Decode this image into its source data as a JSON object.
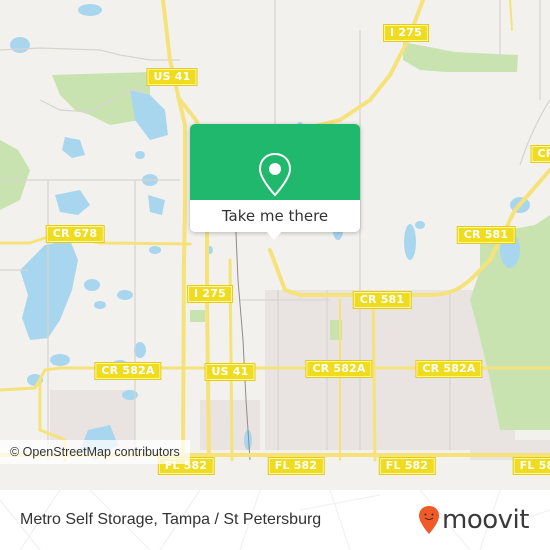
{
  "map": {
    "road_labels": [
      {
        "id": "i275-north",
        "text": "I 275"
      },
      {
        "id": "us41-north",
        "text": "US 41"
      },
      {
        "id": "cr678",
        "text": "CR 678"
      },
      {
        "id": "cr581-east",
        "text": "CR 581"
      },
      {
        "id": "cr581-ne",
        "text": "CR"
      },
      {
        "id": "i275-mid",
        "text": "I 275"
      },
      {
        "id": "cr581-mid",
        "text": "CR 581"
      },
      {
        "id": "cr582a-west",
        "text": "CR 582A"
      },
      {
        "id": "us41-mid",
        "text": "US 41"
      },
      {
        "id": "cr582a-mid",
        "text": "CR 582A"
      },
      {
        "id": "cr582a-east",
        "text": "CR 582A"
      },
      {
        "id": "fl582-1",
        "text": "FL 582"
      },
      {
        "id": "fl582-2",
        "text": "FL 582"
      },
      {
        "id": "fl582-3",
        "text": "FL 582"
      },
      {
        "id": "fl582-4",
        "text": "FL 58"
      }
    ],
    "attribution": "© OpenStreetMap contributors"
  },
  "popup": {
    "icon": "location-pin-icon",
    "button_label": "Take me there",
    "accent_color": "#20b86c"
  },
  "footer": {
    "title": "Metro Self Storage, Tampa / St Petersburg",
    "logo_text": "moovit",
    "logo_color": "#f05a28"
  }
}
